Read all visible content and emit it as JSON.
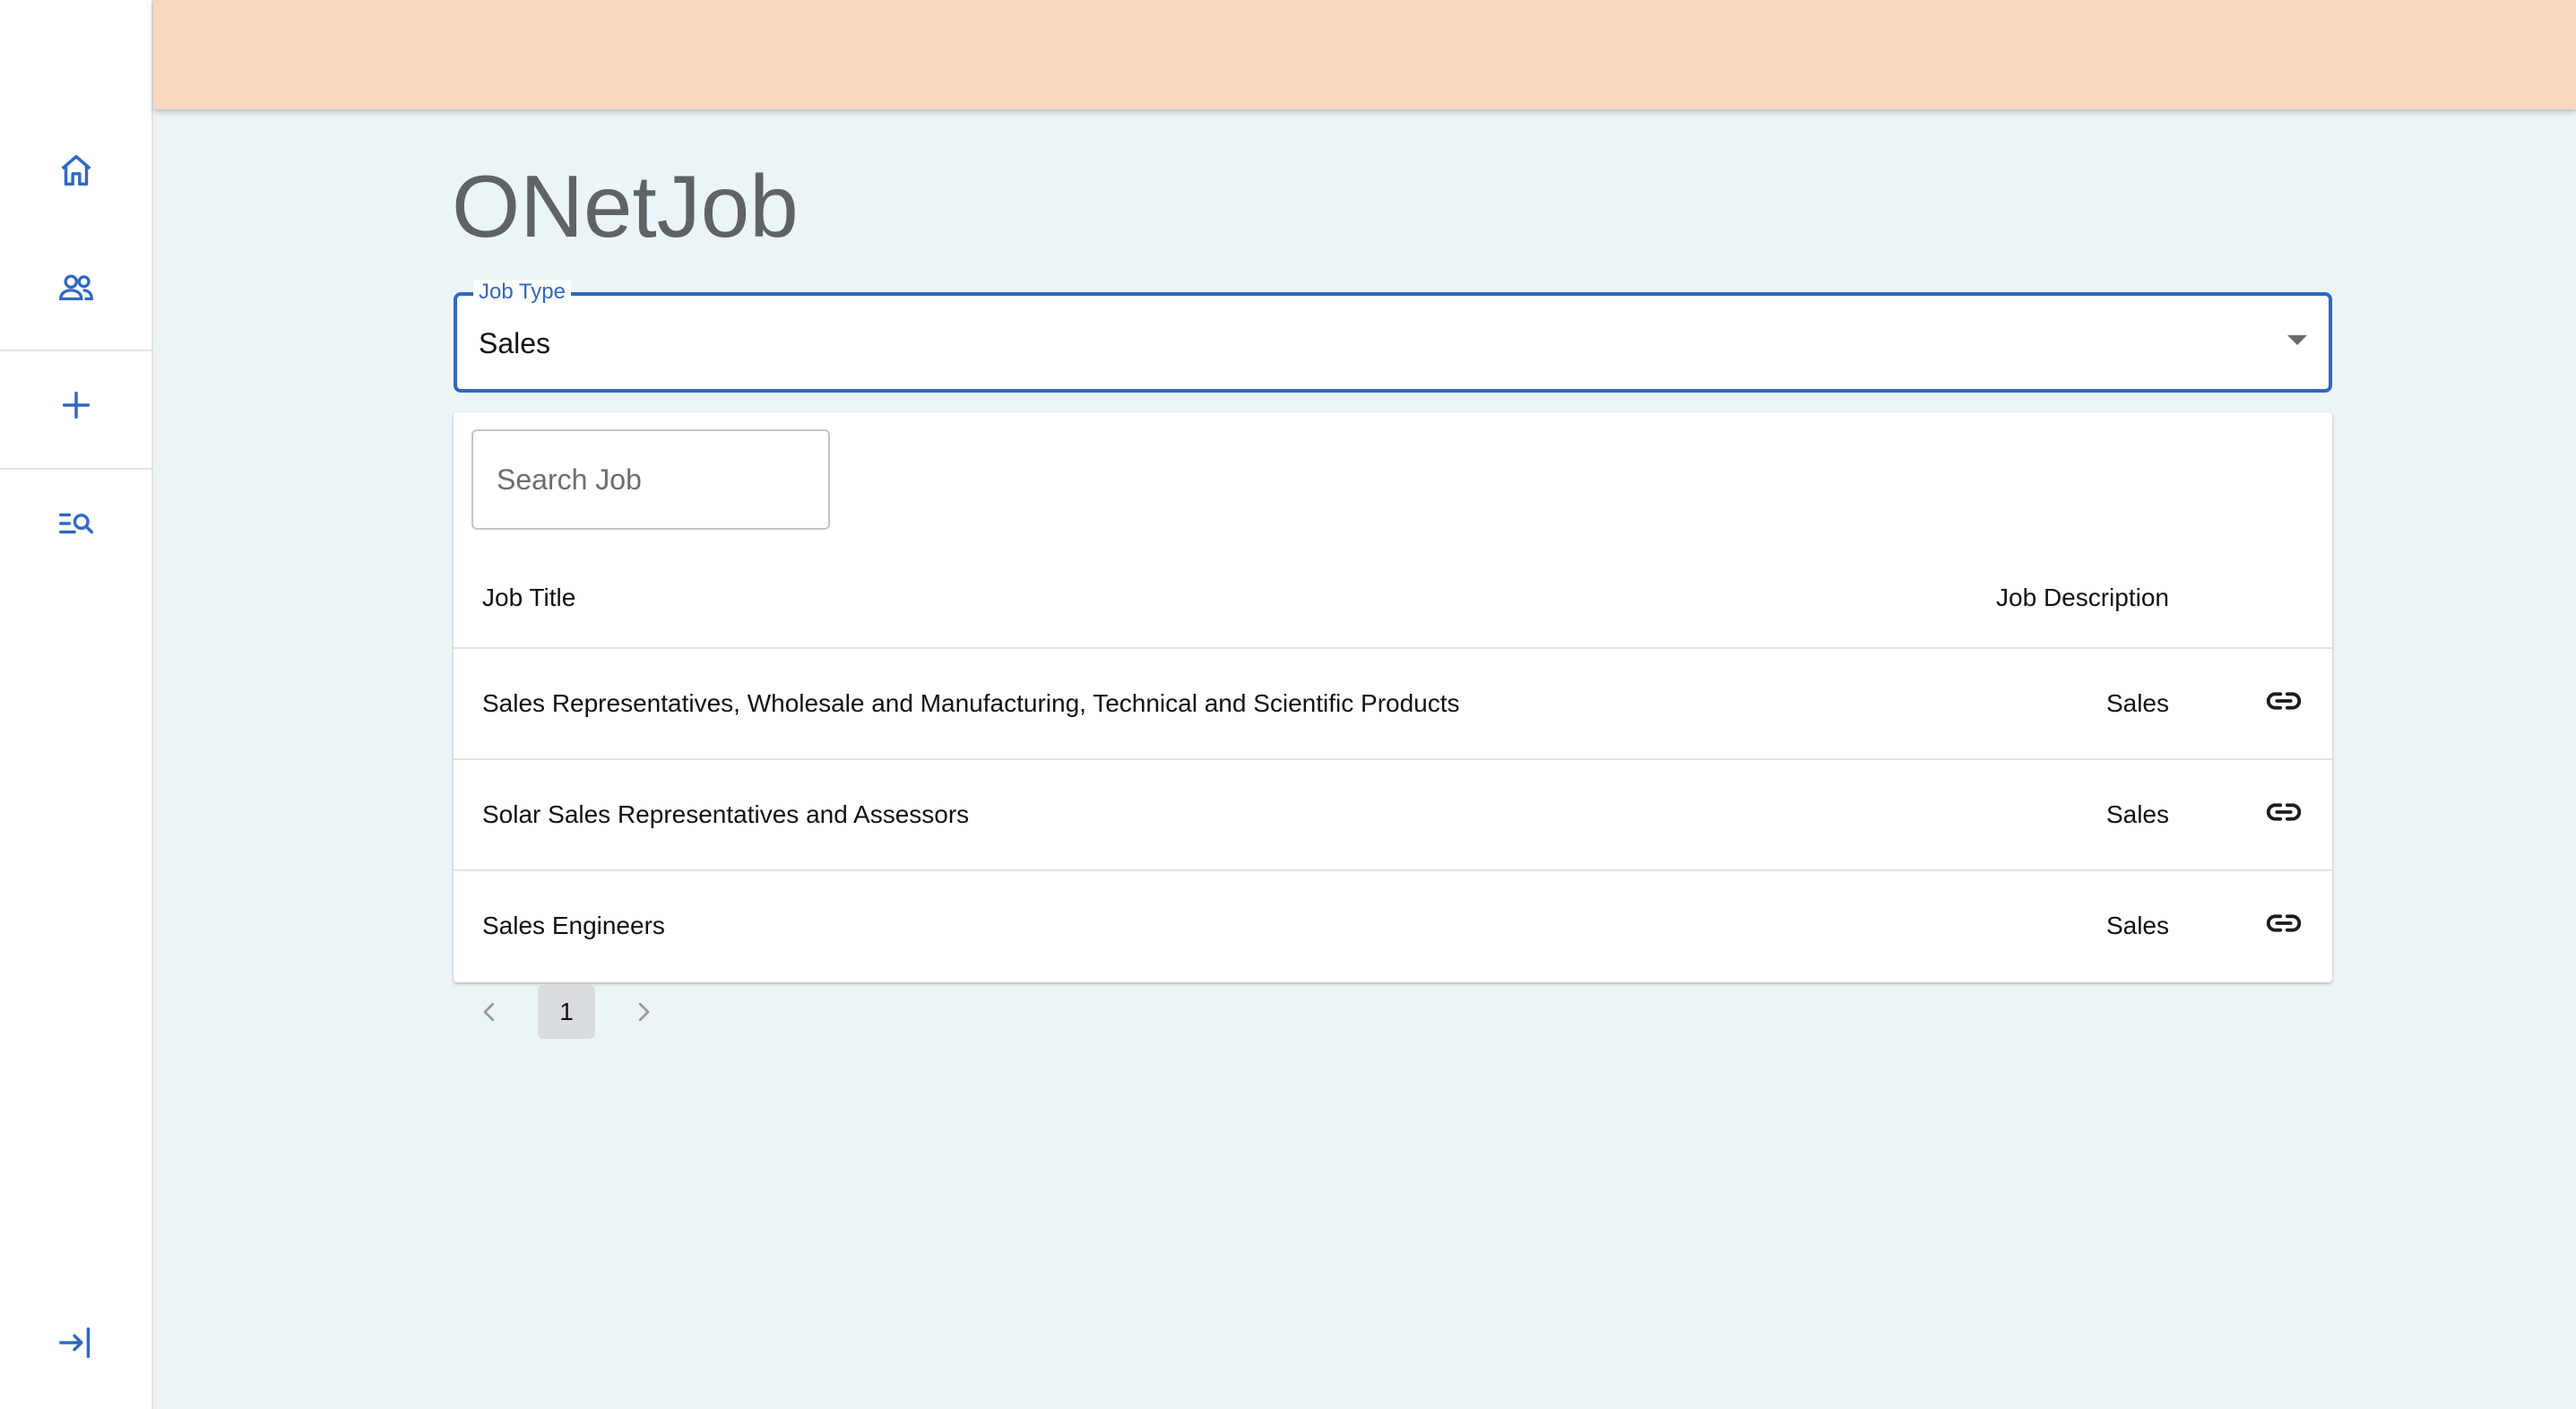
{
  "sidebar": {
    "icons": [
      "home-icon",
      "people-icon",
      "add-icon",
      "search-list-icon",
      "login-icon"
    ]
  },
  "page": {
    "title": "ONetJob"
  },
  "job_type_select": {
    "label": "Job Type",
    "value": "Sales"
  },
  "search": {
    "placeholder": "Search Job",
    "value": ""
  },
  "table": {
    "columns": [
      "Job Title",
      "Job Description"
    ],
    "rows": [
      {
        "title": "Sales Representatives, Wholesale and Manufacturing, Technical and Scientific Products",
        "description": "Sales"
      },
      {
        "title": "Solar Sales Representatives and Assessors",
        "description": "Sales"
      },
      {
        "title": "Sales Engineers",
        "description": "Sales"
      }
    ]
  },
  "pagination": {
    "current_page": "1"
  },
  "colors": {
    "accent": "#2f68c4",
    "appbar": "#f8d8be",
    "background": "#edf4f8"
  }
}
